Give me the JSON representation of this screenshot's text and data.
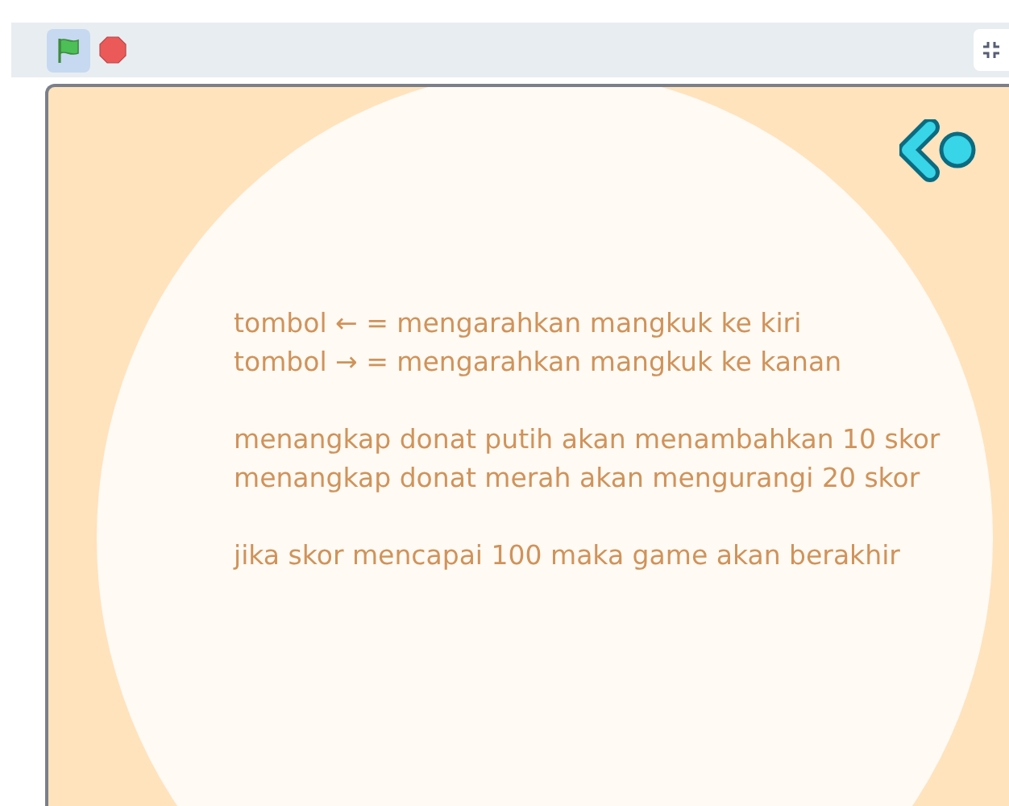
{
  "toolbar": {
    "green_flag": {
      "selected": true
    },
    "stop": {
      "selected": false
    }
  },
  "stage": {
    "paragraphs": [
      [
        "tombol ← = mengarahkan mangkuk ke kiri",
        "tombol → = mengarahkan mangkuk ke kanan"
      ],
      [
        "menangkap donat putih akan menambahkan 10 skor",
        "menangkap donat merah akan mengurangi 20 skor"
      ],
      [
        "jika skor mencapai 100 maka game akan berakhir"
      ]
    ]
  }
}
